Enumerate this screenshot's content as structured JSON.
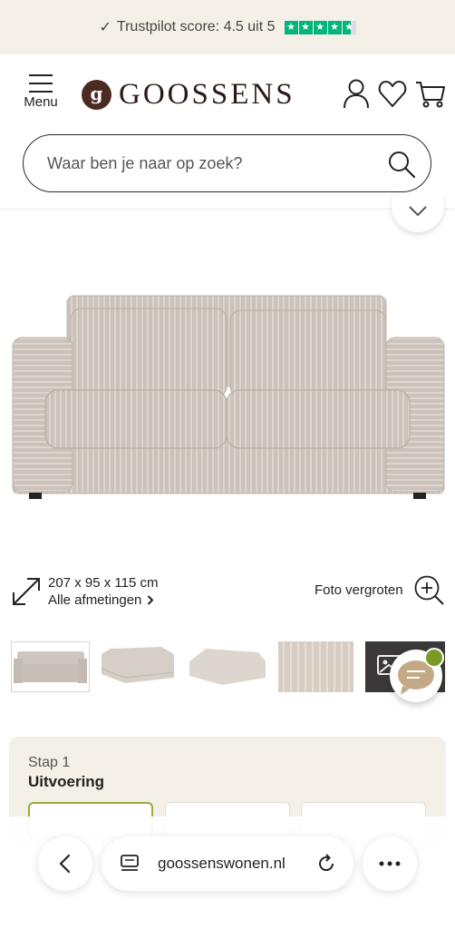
{
  "trustbar": {
    "check": "✓",
    "text": "Trustpilot score: 4.5 uit 5",
    "rating": 4.5,
    "star_color": "#00b67a"
  },
  "header": {
    "menu_label": "Menu",
    "logo_mark": "g",
    "logo_text": "GOOSSENS",
    "brand_color": "#4a2a22",
    "icons": [
      "account-icon",
      "heart-icon",
      "cart-icon"
    ]
  },
  "search": {
    "placeholder": "Waar ben je naar op zoek?",
    "icon": "search-icon"
  },
  "product": {
    "dimensions": "207 x 95 x 115 cm",
    "all_dimensions_link": "Alle afmetingen",
    "zoom_label": "Foto vergroten",
    "thumbnail_count": 5
  },
  "chat": {
    "icon": "chat-icon",
    "status_color": "#7a9a23"
  },
  "step": {
    "label": "Stap 1",
    "title": "Uitvoering",
    "selected_color": "#9aaa3a"
  },
  "browser": {
    "url": "goossenswonen.nl",
    "icons": [
      "back-icon",
      "tabs-icon",
      "reload-icon",
      "more-icon"
    ]
  }
}
